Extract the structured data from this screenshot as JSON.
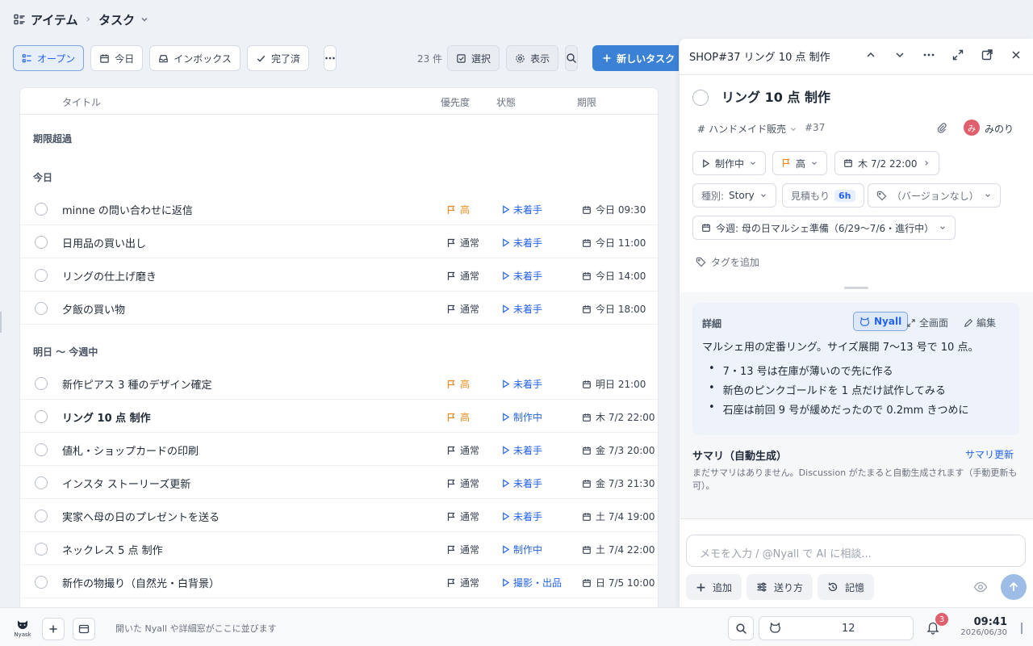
{
  "breadcrumb": {
    "root": "アイテム",
    "current": "タスク"
  },
  "toolbar": {
    "open": "オープン",
    "today": "今日",
    "inbox": "インボックス",
    "done": "完了済",
    "count": "23 件",
    "select": "選択",
    "view": "表示",
    "new_task": "新しいタスク"
  },
  "table": {
    "headers": {
      "title": "タイトル",
      "priority": "優先度",
      "status": "状態",
      "due": "期限"
    },
    "groups": [
      "期限超過",
      "今日",
      "明日 〜 今週中"
    ],
    "today_rows": [
      {
        "title": "minne の問い合わせに返信",
        "priority": "高",
        "status": "未着手",
        "due": "今日 09:30"
      },
      {
        "title": "日用品の買い出し",
        "priority": "通常",
        "status": "未着手",
        "due": "今日 11:00"
      },
      {
        "title": "リングの仕上げ磨き",
        "priority": "通常",
        "status": "未着手",
        "due": "今日 14:00"
      },
      {
        "title": "夕飯の買い物",
        "priority": "通常",
        "status": "未着手",
        "due": "今日 18:00"
      }
    ],
    "week_rows": [
      {
        "title": "新作ピアス 3 種のデザイン確定",
        "priority": "高",
        "status": "未着手",
        "due": "明日 21:00"
      },
      {
        "title": "リング 10 点 制作",
        "priority": "高",
        "status": "制作中",
        "due": "木 7/2 22:00"
      },
      {
        "title": "値札・ショップカードの印刷",
        "priority": "通常",
        "status": "未着手",
        "due": "金 7/3 20:00"
      },
      {
        "title": "インスタ ストーリーズ更新",
        "priority": "通常",
        "status": "未着手",
        "due": "金 7/3 21:30"
      },
      {
        "title": "実家へ母の日のプレゼントを送る",
        "priority": "通常",
        "status": "未着手",
        "due": "土 7/4 19:00"
      },
      {
        "title": "ネックレス 5 点 制作",
        "priority": "通常",
        "status": "制作中",
        "due": "土 7/4 22:00"
      },
      {
        "title": "新作の物撮り（自然光・白背景）",
        "priority": "通常",
        "status": "撮影・出品",
        "due": "日 7/5 10:00"
      }
    ]
  },
  "panel": {
    "header_title": "SHOP#37 リング 10 点 制作",
    "title": "リング 10 点 制作",
    "project": "ハンドメイド販売",
    "number": "#37",
    "assignee_initial": "み",
    "assignee": "みのり",
    "status": "制作中",
    "priority": "高",
    "due": "木 7/2 22:00",
    "type_label": "種別:",
    "type_value": "Story",
    "estimate_label": "見積もり",
    "estimate_value": "6h",
    "version": "（バージョンなし）",
    "sprint": "今週: 母の日マルシェ準備（6/29〜7/6・進行中）",
    "add_tag": "タグを追加",
    "detail": {
      "label": "詳細",
      "nyall": "Nyall",
      "fullscreen": "全画面",
      "edit": "編集",
      "text": "マルシェ用の定番リング。サイズ展開 7〜13 号で 10 点。",
      "bullets": [
        "7・13 号は在庫が薄いので先に作る",
        "新色のピンクゴールドを 1 点だけ試作してみる",
        "石座は前回 9 号が緩めだったので 0.2mm きつめに"
      ]
    },
    "summary": {
      "heading": "サマリ（自動生成）",
      "refresh": "サマリ更新",
      "text": "まだサマリはありません。Discussion がたまると自動生成されます（手動更新も可）。"
    },
    "memo_placeholder": "メモを入力 / @Nyall で AI に相談...",
    "buttons": {
      "add": "追加",
      "send_method": "送り方",
      "memory": "記憶"
    }
  },
  "statusbar": {
    "logo": "Nyask",
    "hint": "開いた Nyall や詳細窓がここに並びます",
    "cat_count": "12",
    "notifications": "3",
    "time": "09:41",
    "date": "2026/06/30"
  },
  "colors": {
    "accent": "#3b82d6",
    "high_priority": "#ea8a1f",
    "status_link": "#2563eb",
    "badge": "#e05f6d"
  }
}
